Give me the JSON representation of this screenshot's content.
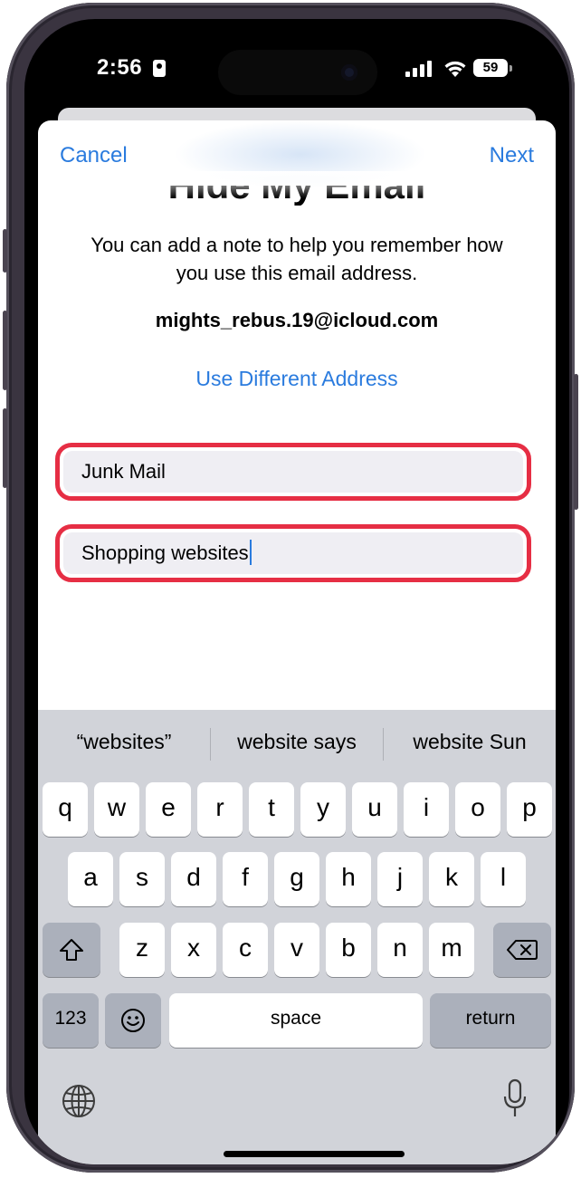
{
  "status_bar": {
    "time": "2:56",
    "battery": "59"
  },
  "nav": {
    "cancel": "Cancel",
    "next": "Next",
    "title": "Hide My Email"
  },
  "content": {
    "description": "You can add a note to help you remember how you use this email address.",
    "email": "mights_rebus.19@icloud.com",
    "use_different": "Use Different Address"
  },
  "fields": {
    "label_value": "Junk Mail",
    "note_value": "Shopping websites"
  },
  "keyboard": {
    "suggestions": [
      "“websites”",
      "website says",
      "website Sun"
    ],
    "row1": [
      "q",
      "w",
      "e",
      "r",
      "t",
      "y",
      "u",
      "i",
      "o",
      "p"
    ],
    "row2": [
      "a",
      "s",
      "d",
      "f",
      "g",
      "h",
      "j",
      "k",
      "l"
    ],
    "row3": [
      "z",
      "x",
      "c",
      "v",
      "b",
      "n",
      "m"
    ],
    "numbers_key": "123",
    "space_key": "space",
    "return_key": "return"
  },
  "colors": {
    "accent": "#2a7bde",
    "highlight": "#e62e44",
    "keyboard_bg": "#d1d3d9"
  }
}
